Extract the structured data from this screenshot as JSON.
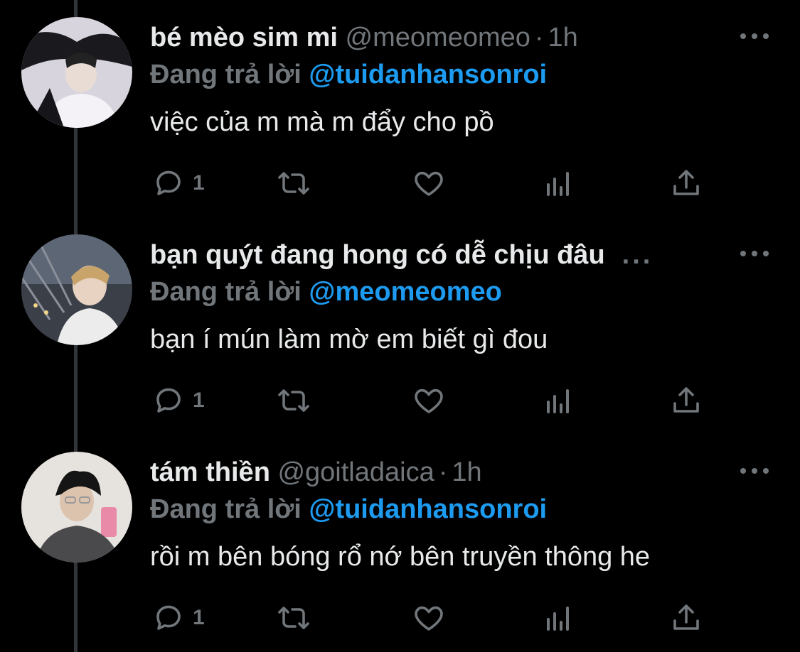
{
  "colors": {
    "background": "#000000",
    "name_text": "#e7e9ea",
    "secondary_text": "#71767b",
    "mention": "#1d9bf0",
    "thread_line": "#333639"
  },
  "icons": {
    "more": "more-horizontal-icon",
    "reply": "reply-bubble-icon",
    "retweet": "retweet-icon",
    "like": "heart-icon",
    "views": "analytics-icon",
    "share": "share-upload-icon"
  },
  "tweets": [
    {
      "name": "bé mèo sim mi",
      "handle": "@meomeomeo",
      "separator": "·",
      "time": "1h",
      "reply_label": "Đang trả lời",
      "reply_to": "@tuidanhansonroi",
      "text": "việc của m mà m đẩy cho pồ",
      "reply_count": "1"
    },
    {
      "name": "bạn quýt đang hong có dễ chịu đâu",
      "truncation": "...",
      "reply_label": "Đang trả lời",
      "reply_to": "@meomeomeo",
      "text": "bạn í mún làm mờ em biết gì đou",
      "reply_count": "1"
    },
    {
      "name": "tám thiền",
      "handle": "@goitladaica",
      "separator": "·",
      "time": "1h",
      "reply_label": "Đang trả lời",
      "reply_to": "@tuidanhansonroi",
      "text": "rồi m bên bóng rổ nớ bên truyền thông he",
      "reply_count": "1"
    }
  ]
}
